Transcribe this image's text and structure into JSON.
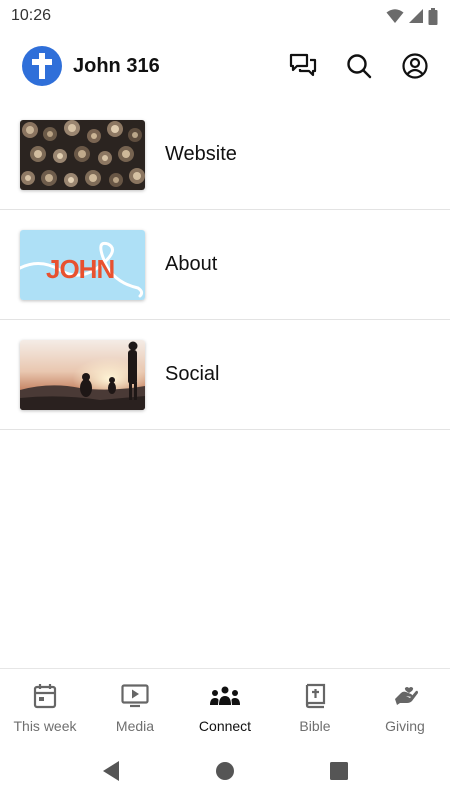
{
  "status": {
    "time": "10:26"
  },
  "header": {
    "title": "John 316"
  },
  "items": [
    {
      "label": "Website"
    },
    {
      "label": "About",
      "thumb_text": "JOHN"
    },
    {
      "label": "Social"
    }
  ],
  "nav": [
    {
      "label": "This week",
      "icon": "calendar-icon"
    },
    {
      "label": "Media",
      "icon": "play-screen-icon"
    },
    {
      "label": "Connect",
      "icon": "people-icon",
      "active": true
    },
    {
      "label": "Bible",
      "icon": "bible-icon"
    },
    {
      "label": "Giving",
      "icon": "giving-hand-icon"
    }
  ],
  "colors": {
    "accent": "#2f6fd9",
    "about_bg": "#aee0f6",
    "about_text": "#e8512f"
  }
}
